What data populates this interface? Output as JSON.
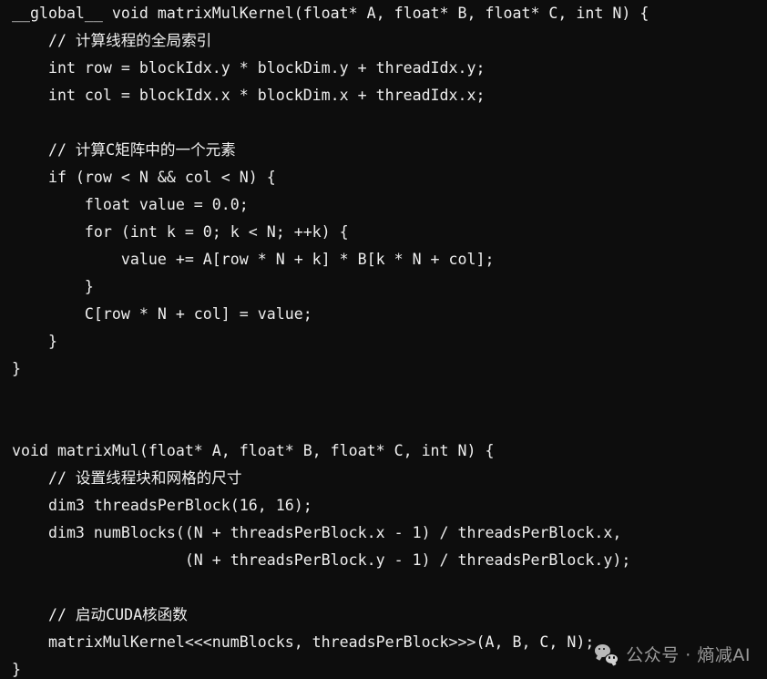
{
  "theme": {
    "background": "#0d0d0d",
    "text_color": "#eeeeee",
    "watermark_color": "#9a9a9a"
  },
  "code": {
    "language": "cuda-c++",
    "lines": [
      "__global__ void matrixMulKernel(float* A, float* B, float* C, int N) {",
      "    // 计算线程的全局索引",
      "    int row = blockIdx.y * blockDim.y + threadIdx.y;",
      "    int col = blockIdx.x * blockDim.x + threadIdx.x;",
      "",
      "    // 计算C矩阵中的一个元素",
      "    if (row < N && col < N) {",
      "        float value = 0.0;",
      "        for (int k = 0; k < N; ++k) {",
      "            value += A[row * N + k] * B[k * N + col];",
      "        }",
      "        C[row * N + col] = value;",
      "    }",
      "}",
      "",
      "",
      "void matrixMul(float* A, float* B, float* C, int N) {",
      "    // 设置线程块和网格的尺寸",
      "    dim3 threadsPerBlock(16, 16);",
      "    dim3 numBlocks((N + threadsPerBlock.x - 1) / threadsPerBlock.x,",
      "                   (N + threadsPerBlock.y - 1) / threadsPerBlock.y);",
      "",
      "    // 启动CUDA核函数",
      "    matrixMulKernel<<<numBlocks, threadsPerBlock>>>(A, B, C, N);",
      "}"
    ],
    "comment_line_indices": [
      1,
      5,
      17,
      22
    ]
  },
  "watermark": {
    "icon": "wechat-icon",
    "text": "公众号 · 熵减AI"
  }
}
